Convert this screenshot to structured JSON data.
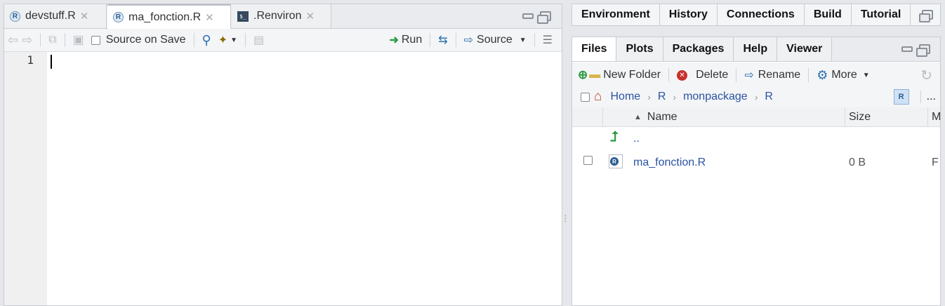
{
  "source_pane": {
    "tabs": [
      {
        "label": "devstuff.R",
        "icon": "r-file-icon",
        "active": false
      },
      {
        "label": "ma_fonction.R",
        "icon": "r-file-icon",
        "active": true
      },
      {
        "label": ".Renviron",
        "icon": "shell-file-icon",
        "active": false
      }
    ],
    "close_glyph": "✕",
    "toolbar": {
      "source_on_save_label": "Source on Save",
      "run_label": "Run",
      "source_label": "Source"
    },
    "line_numbers": [
      "1"
    ]
  },
  "env_pane": {
    "tabs": [
      "Environment",
      "History",
      "Connections",
      "Build",
      "Tutorial"
    ]
  },
  "files_pane": {
    "tabs": [
      "Files",
      "Plots",
      "Packages",
      "Help",
      "Viewer"
    ],
    "active_tab": "Files",
    "toolbar": {
      "new_folder_label": "New Folder",
      "delete_label": "Delete",
      "rename_label": "Rename",
      "more_label": "More"
    },
    "breadcrumb": [
      "Home",
      "R",
      "monpackage",
      "R"
    ],
    "more_crumbs": "...",
    "columns": {
      "name": "Name",
      "size": "Size",
      "modified": "M"
    },
    "parent_dir": "..",
    "files": [
      {
        "name": "ma_fonction.R",
        "size": "0 B",
        "modified": "F"
      }
    ]
  },
  "colors": {
    "link": "#2a53a3",
    "accent_green": "#2e9d45",
    "delete_red": "#c9302c"
  }
}
